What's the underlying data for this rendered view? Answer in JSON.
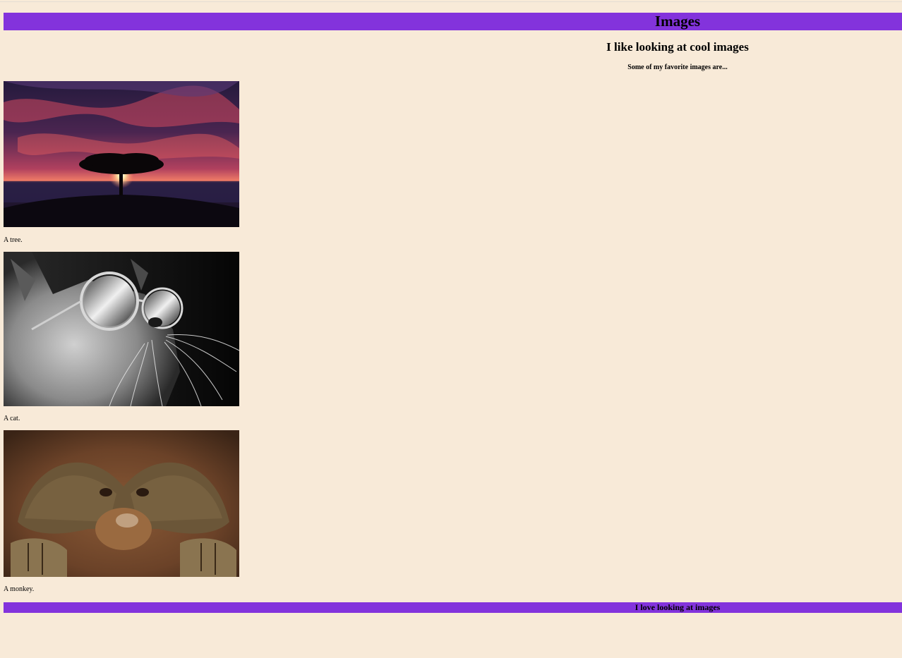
{
  "header": {
    "title": "Images",
    "bar_color": "#8333dc"
  },
  "main": {
    "subtitle": "I like looking at cool images",
    "intro": "Some of my favorite images are...",
    "images": [
      {
        "icon": "tree-sunset-photo",
        "caption": "A tree."
      },
      {
        "icon": "cat-sunglasses-photo",
        "caption": "A cat."
      },
      {
        "icon": "orangutan-photo",
        "caption": "A monkey."
      }
    ]
  },
  "footer": {
    "text": "I love looking at images",
    "bar_color": "#8333dc"
  },
  "colors": {
    "background": "#f8ead8",
    "accent": "#8333dc"
  }
}
